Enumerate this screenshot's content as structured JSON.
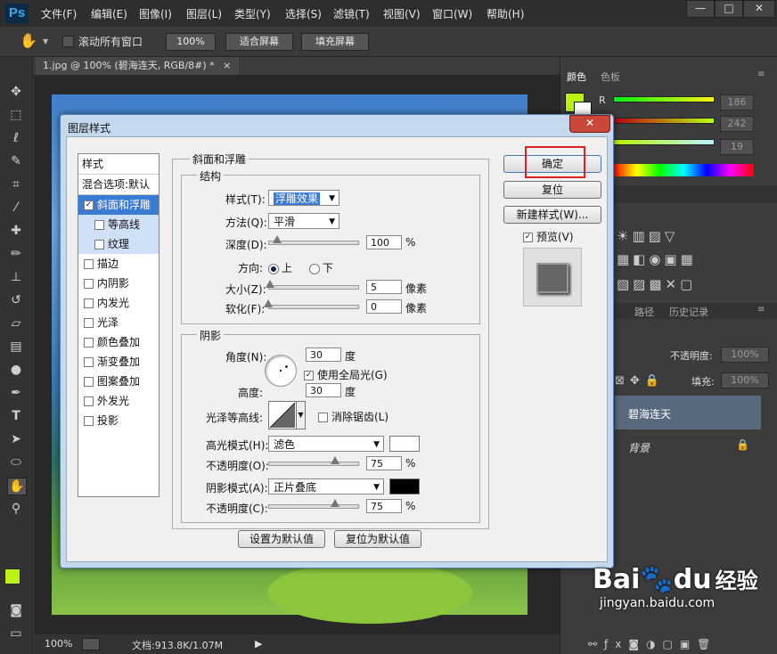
{
  "app": {
    "logo": "Ps"
  },
  "menus": [
    "文件(F)",
    "编辑(E)",
    "图像(I)",
    "图层(L)",
    "类型(Y)",
    "选择(S)",
    "滤镜(T)",
    "视图(V)",
    "窗口(W)",
    "帮助(H)"
  ],
  "window_buttons": [
    "—",
    "□",
    "✕"
  ],
  "options": {
    "scroll_all_label": "滚动所有窗口",
    "zoom_label": "100%",
    "fit_screen_label": "适合屏幕",
    "fill_screen_label": "填充屏幕"
  },
  "document": {
    "tab_title": "1.jpg @ 100% (碧海连天, RGB/8#) *",
    "tab_close": "×"
  },
  "status": {
    "zoom": "100%",
    "doc_info": "文档:913.8K/1.07M"
  },
  "panels": {
    "color_tab": "颜色",
    "swatch_tab": "色板",
    "channels": [
      {
        "label": "R",
        "value": "186"
      },
      {
        "label": "G",
        "value": "242"
      },
      {
        "label": "B",
        "value": "19"
      }
    ],
    "fg_color": "#b9f213",
    "layers_tabs": [
      "路径",
      "历史记录"
    ],
    "opacity_label": "不透明度:",
    "opacity_value": "100%",
    "fill_label": "填充:",
    "fill_value": "100%",
    "layers": [
      {
        "name": "碧海连天",
        "selected": true
      },
      {
        "name": "背景",
        "selected": false
      }
    ]
  },
  "dialog": {
    "title": "图层样式",
    "close": "✕",
    "styles_header": "样式",
    "blend_options": "混合选项:默认",
    "styles": [
      {
        "label": "斜面和浮雕",
        "checked": true,
        "selected": true,
        "indent": false
      },
      {
        "label": "等高线",
        "checked": false,
        "selected": true,
        "indent": true
      },
      {
        "label": "纹理",
        "checked": false,
        "selected": true,
        "indent": true
      },
      {
        "label": "描边",
        "checked": false,
        "selected": false,
        "indent": false
      },
      {
        "label": "内阴影",
        "checked": false,
        "selected": false,
        "indent": false
      },
      {
        "label": "内发光",
        "checked": false,
        "selected": false,
        "indent": false
      },
      {
        "label": "光泽",
        "checked": false,
        "selected": false,
        "indent": false
      },
      {
        "label": "颜色叠加",
        "checked": false,
        "selected": false,
        "indent": false
      },
      {
        "label": "渐变叠加",
        "checked": false,
        "selected": false,
        "indent": false
      },
      {
        "label": "图案叠加",
        "checked": false,
        "selected": false,
        "indent": false
      },
      {
        "label": "外发光",
        "checked": false,
        "selected": false,
        "indent": false
      },
      {
        "label": "投影",
        "checked": false,
        "selected": false,
        "indent": false
      }
    ],
    "section_title": "斜面和浮雕",
    "structure": {
      "title": "结构",
      "style_label": "样式(T):",
      "style_value": "浮雕效果",
      "method_label": "方法(Q):",
      "method_value": "平滑",
      "depth_label": "深度(D):",
      "depth_value": "100",
      "depth_unit": "%",
      "depth_fraction": 0.1,
      "direction_label": "方向:",
      "dir_up": "上",
      "dir_down": "下",
      "size_label": "大小(Z):",
      "size_value": "5",
      "size_unit": "像素",
      "size_fraction": 0.02,
      "soften_label": "软化(F):",
      "soften_value": "0",
      "soften_unit": "像素",
      "soften_fraction": 0.0
    },
    "shading": {
      "title": "阴影",
      "angle_label": "角度(N):",
      "angle_value": "30",
      "angle_unit": "度",
      "global_light_label": "使用全局光(G)",
      "altitude_label": "高度:",
      "altitude_value": "30",
      "altitude_unit": "度",
      "gloss_label": "光泽等高线:",
      "antialias_label": "消除锯齿(L)",
      "highlight_label": "高光模式(H):",
      "highlight_mode": "滤色",
      "highlight_color": "#ffffff",
      "hl_opacity_label": "不透明度(O):",
      "hl_opacity_value": "75",
      "hl_unit": "%",
      "hl_fraction": 0.75,
      "shadow_label": "阴影模式(A):",
      "shadow_mode": "正片叠底",
      "shadow_color": "#000000",
      "sh_opacity_label": "不透明度(C):",
      "sh_opacity_value": "75",
      "sh_unit": "%",
      "sh_fraction": 0.75
    },
    "make_default": "设置为默认值",
    "reset_default": "复位为默认值",
    "ok": "确定",
    "reset": "复位",
    "new_style": "新建样式(W)...",
    "preview_label": "预览(V)"
  },
  "watermark": {
    "brand": "Bai",
    "brand2": "du",
    "jingyan": "经验",
    "url": "jingyan.baidu.com"
  }
}
